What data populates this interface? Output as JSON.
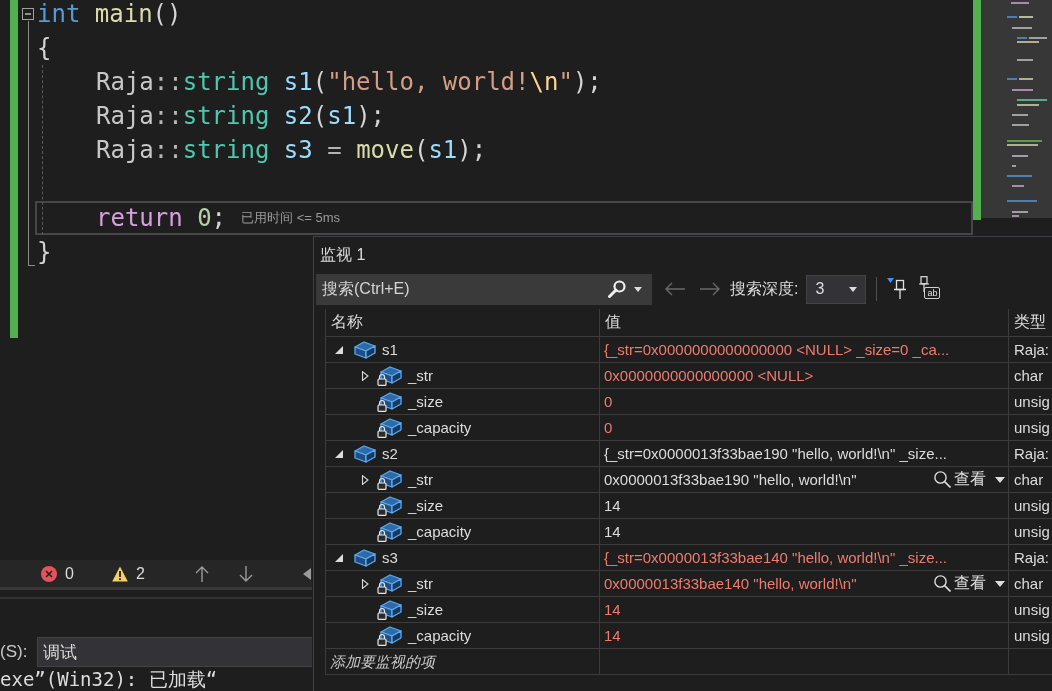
{
  "editor": {
    "function": {
      "expanded": true,
      "signature": [
        {
          "kind": "keyword",
          "text": "int"
        },
        {
          "kind": "function",
          "text": " main"
        },
        {
          "kind": "punct",
          "text": "()"
        }
      ],
      "open_brace": "{",
      "body": [
        {
          "kind": "statement",
          "current": false,
          "tokens": [
            {
              "kind": "namespace",
              "text": "Raja"
            },
            {
              "kind": "operator",
              "text": "::"
            },
            {
              "kind": "type",
              "text": "string"
            },
            {
              "kind": "variable",
              "text": " s1"
            },
            {
              "kind": "punct",
              "text": "("
            },
            {
              "kind": "string",
              "text": "\"hello, world!"
            },
            {
              "kind": "escape",
              "text": "\\n"
            },
            {
              "kind": "string",
              "text": "\""
            },
            {
              "kind": "punct",
              "text": ");"
            }
          ]
        },
        {
          "kind": "statement",
          "current": false,
          "tokens": [
            {
              "kind": "namespace",
              "text": "Raja"
            },
            {
              "kind": "operator",
              "text": "::"
            },
            {
              "kind": "type",
              "text": "string"
            },
            {
              "kind": "variable",
              "text": " s2"
            },
            {
              "kind": "punct",
              "text": "("
            },
            {
              "kind": "variable",
              "text": "s1"
            },
            {
              "kind": "punct",
              "text": ");"
            }
          ]
        },
        {
          "kind": "statement",
          "current": false,
          "tokens": [
            {
              "kind": "namespace",
              "text": "Raja"
            },
            {
              "kind": "operator",
              "text": "::"
            },
            {
              "kind": "type",
              "text": "string"
            },
            {
              "kind": "variable",
              "text": " s3"
            },
            {
              "kind": "operator",
              "text": " = "
            },
            {
              "kind": "function",
              "text": "move"
            },
            {
              "kind": "punct",
              "text": "("
            },
            {
              "kind": "variable",
              "text": "s1"
            },
            {
              "kind": "punct",
              "text": ");"
            }
          ]
        },
        {
          "kind": "blank",
          "current": false
        },
        {
          "kind": "statement",
          "current": true,
          "tokens": [
            {
              "kind": "control",
              "text": "return"
            },
            {
              "kind": "number",
              "text": " 0"
            },
            {
              "kind": "punct",
              "text": ";"
            }
          ],
          "hint": "已用时间 <= 5ms"
        }
      ],
      "close_brace": "}"
    }
  },
  "error_list": {
    "error_count": "0",
    "warning_count": "2"
  },
  "output": {
    "source_label": "(S):",
    "source": "调试",
    "text": "exe”(Win32): 已加载“"
  },
  "watch": {
    "title": "监视 1",
    "search": {
      "placeholder": "搜索(Ctrl+E)"
    },
    "nav": [
      {
        "kind": "back",
        "disabled": true
      },
      {
        "kind": "forward",
        "disabled": true
      }
    ],
    "depth": {
      "label": "搜索深度:",
      "value": "3"
    },
    "pin_button_text": "ab",
    "columns": [
      "名称",
      "值",
      "类型"
    ],
    "rows": [
      {
        "name": "s1",
        "kind": "variable",
        "expandable": true,
        "expanded": true,
        "changed": true,
        "value": "{_str=0x0000000000000000 <NULL> _size=0 _ca...",
        "type": "Raja:",
        "children": [
          {
            "name": "_str",
            "kind": "private_member",
            "expandable": true,
            "expanded": false,
            "changed": true,
            "value": "0x0000000000000000 <NULL>",
            "type": "char"
          },
          {
            "name": "_size",
            "kind": "private_member",
            "expandable": false,
            "expanded": false,
            "changed": true,
            "value": "0",
            "type": "unsig"
          },
          {
            "name": "_capacity",
            "kind": "private_member",
            "expandable": false,
            "expanded": false,
            "changed": true,
            "value": "0",
            "type": "unsig"
          }
        ]
      },
      {
        "name": "s2",
        "kind": "variable",
        "expandable": true,
        "expanded": true,
        "changed": false,
        "value": "{_str=0x0000013f33bae190 \"hello, world!\\n\" _size...",
        "type": "Raja:",
        "children": [
          {
            "name": "_str",
            "kind": "private_member",
            "expandable": true,
            "expanded": false,
            "changed": false,
            "value": "0x0000013f33bae190 \"hello, world!\\n\"",
            "visualizer": "查看",
            "type": "char"
          },
          {
            "name": "_size",
            "kind": "private_member",
            "expandable": false,
            "expanded": false,
            "changed": false,
            "value": "14",
            "type": "unsig"
          },
          {
            "name": "_capacity",
            "kind": "private_member",
            "expandable": false,
            "expanded": false,
            "changed": false,
            "value": "14",
            "type": "unsig"
          }
        ]
      },
      {
        "name": "s3",
        "kind": "variable",
        "expandable": true,
        "expanded": true,
        "changed": true,
        "value": "{_str=0x0000013f33bae140 \"hello, world!\\n\" _size...",
        "type": "Raja:",
        "children": [
          {
            "name": "_str",
            "kind": "private_member",
            "expandable": true,
            "expanded": false,
            "changed": true,
            "value": "0x0000013f33bae140 \"hello, world!\\n\"",
            "visualizer": "查看",
            "type": "char"
          },
          {
            "name": "_size",
            "kind": "private_member",
            "expandable": false,
            "expanded": false,
            "changed": true,
            "value": "14",
            "type": "unsig"
          },
          {
            "name": "_capacity",
            "kind": "private_member",
            "expandable": false,
            "expanded": false,
            "changed": true,
            "value": "14",
            "type": "unsig"
          }
        ]
      }
    ],
    "add_placeholder": "添加要监视的项"
  }
}
